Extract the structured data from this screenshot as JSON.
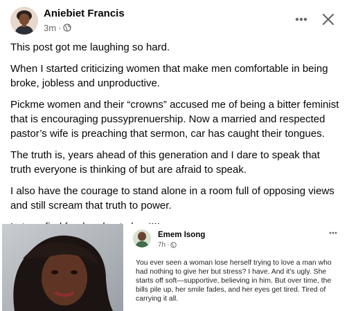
{
  "post": {
    "author": "Aniebiet Francis",
    "time": "3m",
    "separator": "·",
    "audience_icon": "globe-icon",
    "more_icon": "more-horizontal-icon",
    "close_icon": "close-icon",
    "paragraphs": [
      "This post got me laughing so hard.",
      "When I started criticizing women that make men comfortable in being broke, jobless and unproductive.",
      "Pickme women and their “crowns” accused me of being a bitter feminist that is encouraging pussyprenuership.  Now a married and respected pastor’s wife is preaching that sermon, car has caught their tongues.",
      "The truth is, years ahead of this generation and I dare to speak that truth everyone is thinking of but are afraid to speak.",
      "I also have the courage to stand alone in a room full of opposing views and still scream that truth to power.",
      "Let me find food and eat abeg!!!!"
    ]
  },
  "attachment": {
    "inner_post": {
      "author": "Emem Isong",
      "time": "7h",
      "separator": "·",
      "audience_icon": "globe-icon",
      "more_icon": "more-horizontal-icon",
      "text": "You ever seen a woman lose herself trying to love a man who had nothing to give her but stress? I have. And it’s ugly. She starts off soft—supportive, believing in him. But over time, the bills pile up, her smile fades, and her eyes get tired. Tired of carrying it all."
    }
  },
  "colors": {
    "text": "#050505",
    "secondary_text": "#65676b",
    "background": "#ffffff",
    "attachment_background": "#f0f2f5"
  }
}
